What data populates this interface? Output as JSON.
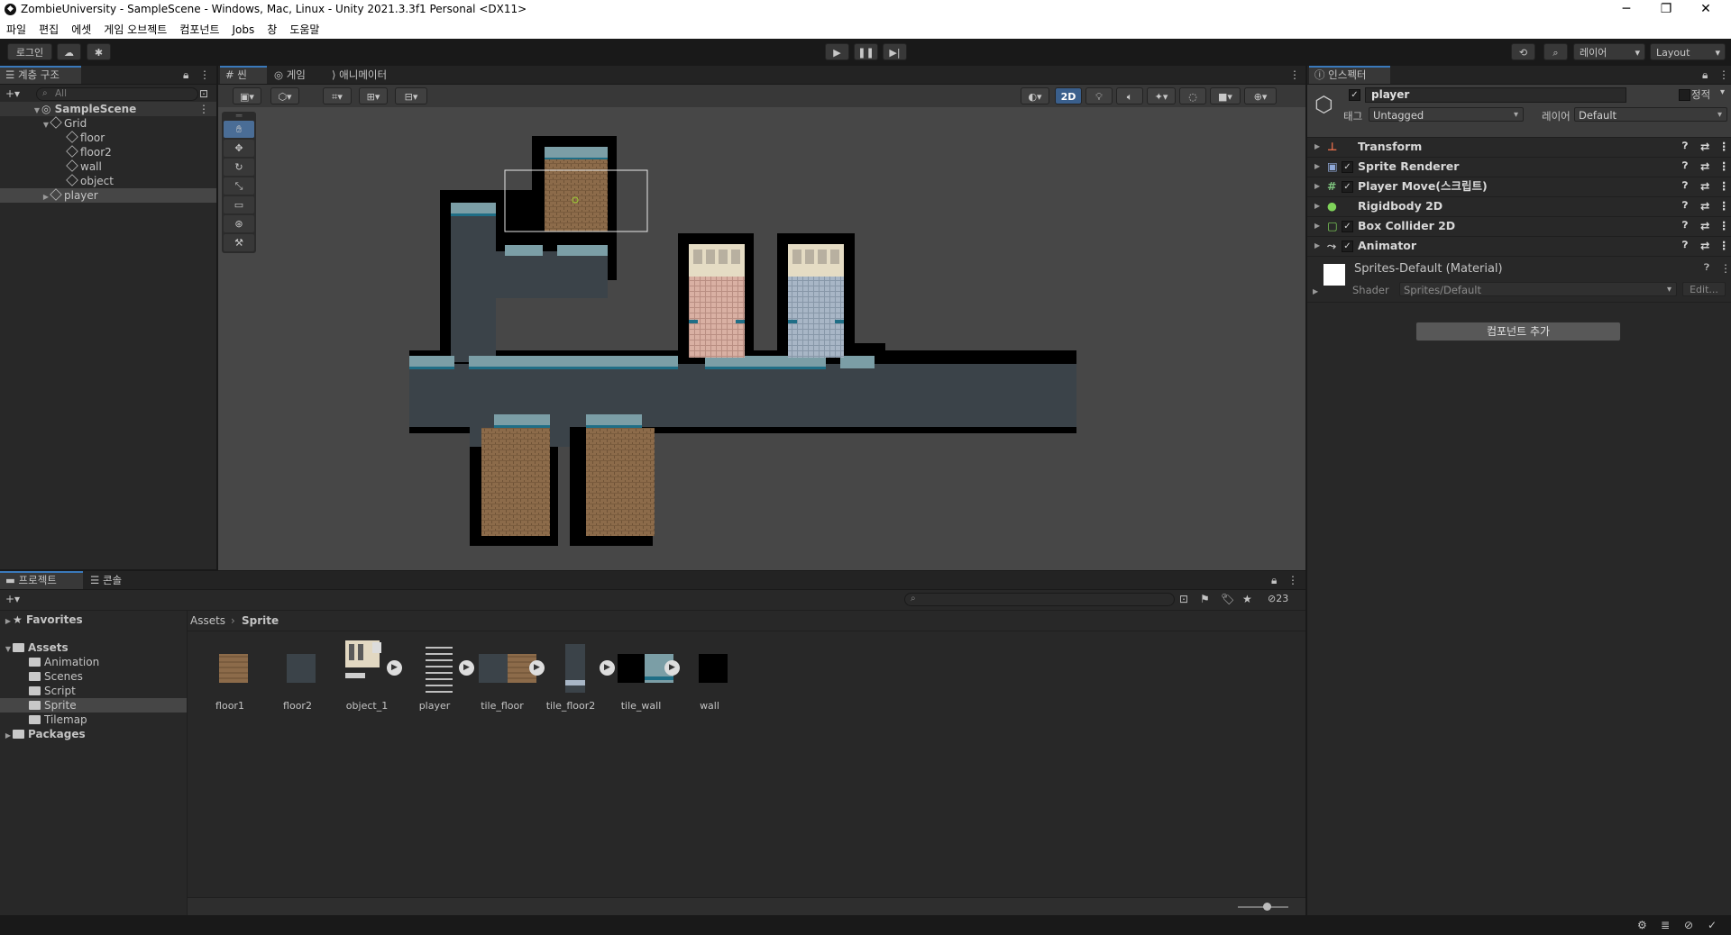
{
  "window": {
    "title": "ZombieUniversity - SampleScene - Windows, Mac, Linux - Unity 2021.3.3f1 Personal <DX11>",
    "controls": [
      "─",
      "❐",
      "✕"
    ]
  },
  "menu": [
    "파일",
    "편집",
    "에셋",
    "게임 오브젝트",
    "컴포넌트",
    "Jobs",
    "창",
    "도움말"
  ],
  "toolbar": {
    "login": "로그인",
    "layers": "레이어",
    "layout": "Layout"
  },
  "hierarchy": {
    "tab": "계층 구조",
    "search_placeholder": "All",
    "items": [
      {
        "label": "SampleScene"
      },
      {
        "label": "Grid"
      },
      {
        "label": "floor"
      },
      {
        "label": "floor2"
      },
      {
        "label": "wall"
      },
      {
        "label": "object"
      },
      {
        "label": "player"
      }
    ]
  },
  "scene": {
    "tabs": [
      "씬",
      "게임",
      "애니메이터"
    ],
    "mode_2d": "2D"
  },
  "inspector": {
    "tab": "인스펙터",
    "object_name": "player",
    "static_label": "정적",
    "tag_label": "태그",
    "tag_value": "Untagged",
    "layer_label": "레이어",
    "layer_value": "Default",
    "components": [
      "Transform",
      "Sprite Renderer",
      "Player Move(스크립트)",
      "Rigidbody 2D",
      "Box Collider 2D",
      "Animator"
    ],
    "material_name": "Sprites-Default (Material)",
    "shader_label": "Shader",
    "shader_value": "Sprites/Default",
    "edit_label": "Edit...",
    "add_component": "컴포넌트 추가"
  },
  "project": {
    "tabs": [
      "프로젝트",
      "콘솔"
    ],
    "hidden_count": "23",
    "tree": {
      "favorites": "Favorites",
      "assets": "Assets",
      "folders": [
        "Animation",
        "Scenes",
        "Script",
        "Sprite",
        "Tilemap"
      ],
      "packages": "Packages"
    },
    "breadcrumb": {
      "root": "Assets",
      "current": "Sprite"
    },
    "assets": [
      "floor1",
      "floor2",
      "object_1",
      "player",
      "tile_floor",
      "tile_floor2",
      "tile_wall",
      "wall"
    ]
  },
  "colors": {
    "accent_blue": "#3a79bb",
    "wall_black": "#000000",
    "wood": "#8a6a48",
    "teal": "#7a9ca6"
  }
}
